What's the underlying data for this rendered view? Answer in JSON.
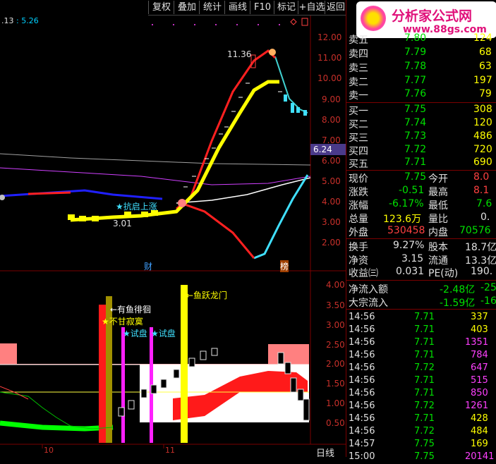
{
  "toolbar": {
    "buttons": [
      "复权",
      "叠加",
      "统计",
      "画线",
      "F10",
      "标记",
      "+自选",
      "返回"
    ]
  },
  "header": {
    "ma_text_a": ".13",
    "ma_text_b": ": 5.26"
  },
  "logo": {
    "title": "分析家公式网",
    "url": "www.88gs.com"
  },
  "upper_axis": [
    "12.00",
    "11.00",
    "10.00",
    "9.00",
    "8.00",
    "7.00",
    "6.00",
    "5.00",
    "4.00",
    "3.00",
    "2.00"
  ],
  "current_price_tag": "6.24",
  "lower_axis": [
    "4.00",
    "3.50",
    "3.00",
    "2.50",
    "2.00",
    "1.50",
    "1.00",
    "0.50"
  ],
  "annotations": {
    "high_label": "11.36",
    "low_label": "3.01",
    "kang_label": "★抗启上涨",
    "cai_label": "财",
    "bang_label": "榜",
    "yu_paihui": "←有鱼徘徊",
    "bugan": "★不甘寂寞",
    "shipan1": "★试盘",
    "shipan2": "★试盘",
    "yuyue": "←鱼跃龙门"
  },
  "x_axis": [
    "10",
    "11"
  ],
  "period": "日线",
  "order_book": [
    {
      "label": "卖五",
      "price": "7.80",
      "vol": "124"
    },
    {
      "label": "卖四",
      "price": "7.79",
      "vol": "68"
    },
    {
      "label": "卖三",
      "price": "7.78",
      "vol": "63"
    },
    {
      "label": "卖二",
      "price": "7.77",
      "vol": "197"
    },
    {
      "label": "卖一",
      "price": "7.76",
      "vol": "79"
    },
    {
      "label": "买一",
      "price": "7.75",
      "vol": "308"
    },
    {
      "label": "买二",
      "price": "7.74",
      "vol": "120"
    },
    {
      "label": "买三",
      "price": "7.73",
      "vol": "486"
    },
    {
      "label": "买四",
      "price": "7.72",
      "vol": "720"
    },
    {
      "label": "买五",
      "price": "7.71",
      "vol": "690"
    }
  ],
  "stats": [
    {
      "l1": "现价",
      "v1": "7.75",
      "l2": "今开",
      "v2": "8.0"
    },
    {
      "l1": "涨跌",
      "v1": "-0.51",
      "l2": "最高",
      "v2": "8.1"
    },
    {
      "l1": "涨幅",
      "v1": "-6.17%",
      "l2": "最低",
      "v2": "7.6"
    },
    {
      "l1": "总量",
      "v1": "123.6万",
      "l2": "量比",
      "v2": "0."
    },
    {
      "l1": "外盘",
      "v1": "530458",
      "l2": "内盘",
      "v2": "70576"
    }
  ],
  "stats2": [
    {
      "l1": "换手",
      "v1": "9.27%",
      "l2": "股本",
      "v2": "18.7亿"
    },
    {
      "l1": "净资",
      "v1": "3.15",
      "l2": "流通",
      "v2": "13.3亿"
    },
    {
      "l1": "收益㈢",
      "v1": "0.031",
      "l2": "PE(动)",
      "v2": "190."
    }
  ],
  "flows": [
    {
      "label": "净流入额",
      "v1": "-2.48亿",
      "v2": "-25"
    },
    {
      "label": "大宗流入",
      "v1": "-1.59亿",
      "v2": "-16"
    }
  ],
  "ticks": [
    {
      "time": "14:56",
      "price": "7.71",
      "vol": "337"
    },
    {
      "time": "14:56",
      "price": "7.71",
      "vol": "403"
    },
    {
      "time": "14:56",
      "price": "7.71",
      "vol": "1351"
    },
    {
      "time": "14:56",
      "price": "7.71",
      "vol": "784"
    },
    {
      "time": "14:56",
      "price": "7.72",
      "vol": "647"
    },
    {
      "time": "14:56",
      "price": "7.71",
      "vol": "515"
    },
    {
      "time": "14:56",
      "price": "7.71",
      "vol": "850"
    },
    {
      "time": "14:56",
      "price": "7.72",
      "vol": "1261"
    },
    {
      "time": "14:56",
      "price": "7.71",
      "vol": "428"
    },
    {
      "time": "14:56",
      "price": "7.72",
      "vol": "484"
    },
    {
      "time": "14:57",
      "price": "7.75",
      "vol": "169"
    },
    {
      "time": "15:00",
      "price": "7.75",
      "vol": "20141"
    }
  ],
  "colors": {
    "up": "#ff3030",
    "down": "#00e000",
    "bg": "#000000",
    "grid": "#7a0000"
  }
}
